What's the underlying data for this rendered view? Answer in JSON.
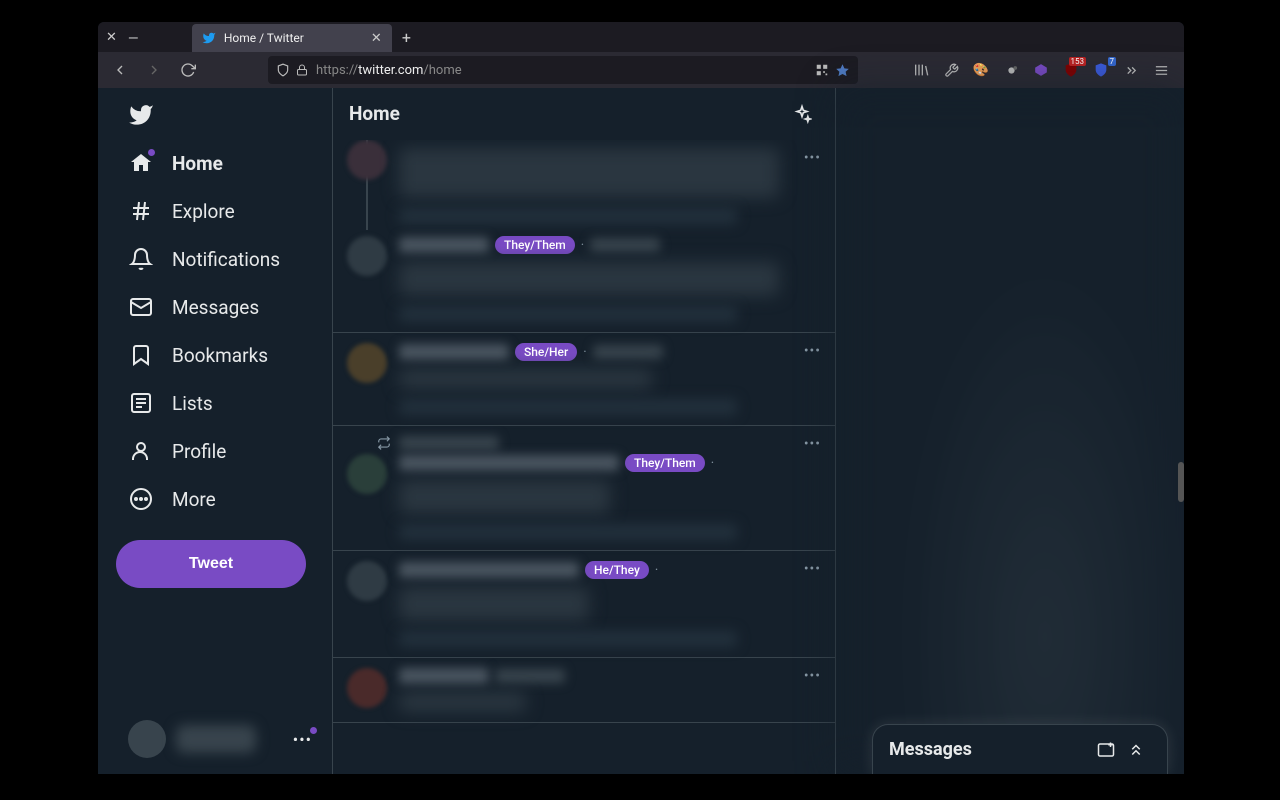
{
  "browser": {
    "tab_title": "Home / Twitter",
    "url_prefix": "https://",
    "url_domain": "twitter.com",
    "url_path": "/home",
    "ext_badge": "153",
    "ext_badge2": "7"
  },
  "sidebar": {
    "items": [
      {
        "label": "Home",
        "active": true,
        "dot": true
      },
      {
        "label": "Explore"
      },
      {
        "label": "Notifications"
      },
      {
        "label": "Messages"
      },
      {
        "label": "Bookmarks"
      },
      {
        "label": "Lists"
      },
      {
        "label": "Profile"
      },
      {
        "label": "More"
      }
    ],
    "tweet_button": "Tweet"
  },
  "main": {
    "title": "Home"
  },
  "feed": {
    "items": [
      {
        "pronoun": null,
        "thread": true,
        "tall": true
      },
      {
        "pronoun": "They/Them",
        "tall": false
      },
      {
        "pronoun": "She/Her",
        "tall": false
      },
      {
        "pronoun": "They/Them",
        "retweet": true,
        "tall": false
      },
      {
        "pronoun": "He/They",
        "tall": false
      },
      {
        "pronoun": null,
        "short": true
      }
    ]
  },
  "messages_drawer": {
    "title": "Messages"
  }
}
